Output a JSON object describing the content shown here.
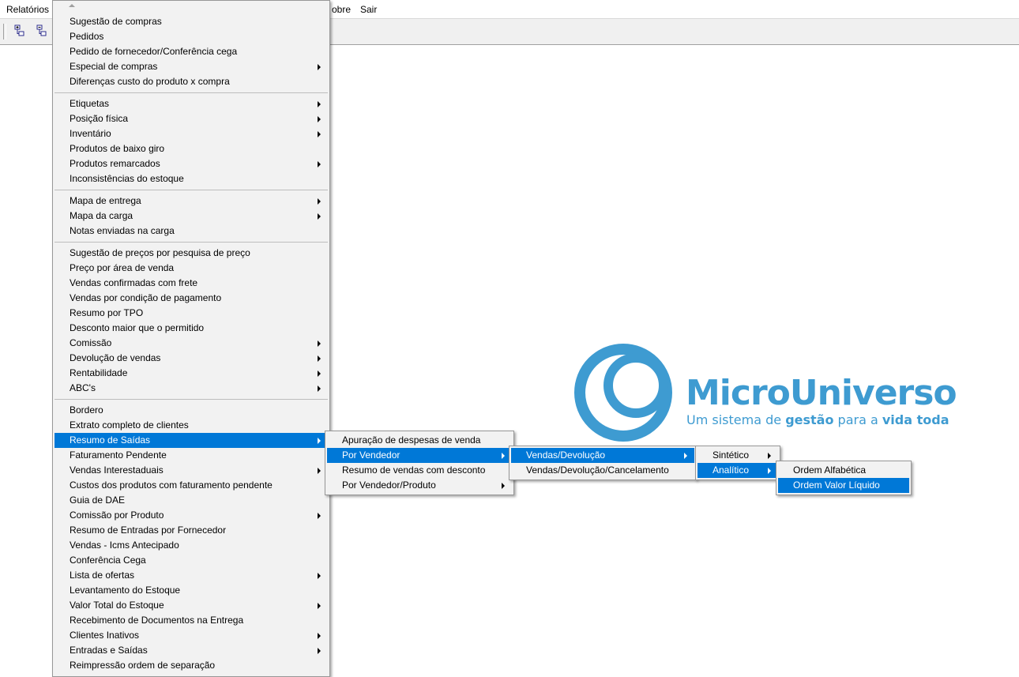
{
  "menubar": {
    "items": [
      {
        "label": "Relatórios"
      },
      {
        "label": "obre"
      },
      {
        "label": "Sair"
      }
    ]
  },
  "toolbar": {
    "buttons": [
      {
        "icon": "tree-expand-icon"
      },
      {
        "icon": "tree-collapse-icon"
      }
    ]
  },
  "main_menu": {
    "items": [
      {
        "label": "Sugestão de compras"
      },
      {
        "label": "Pedidos"
      },
      {
        "label": "Pedido de fornecedor/Conferência cega"
      },
      {
        "label": "Especial de compras",
        "submenu": true
      },
      {
        "label": "Diferenças custo do produto x compra"
      },
      {
        "label": "Etiquetas",
        "submenu": true
      },
      {
        "label": "Posição física",
        "submenu": true
      },
      {
        "label": "Inventário",
        "submenu": true
      },
      {
        "label": "Produtos de baixo giro"
      },
      {
        "label": "Produtos remarcados",
        "submenu": true
      },
      {
        "label": "Inconsistências do estoque"
      },
      {
        "label": "Mapa de entrega",
        "submenu": true
      },
      {
        "label": "Mapa da carga",
        "submenu": true
      },
      {
        "label": "Notas enviadas na carga"
      },
      {
        "label": "Sugestão de preços por pesquisa de preço"
      },
      {
        "label": "Preço por área de venda"
      },
      {
        "label": "Vendas confirmadas com frete"
      },
      {
        "label": "Vendas por condição de pagamento"
      },
      {
        "label": "Resumo por TPO"
      },
      {
        "label": "Desconto maior que o permitido"
      },
      {
        "label": "Comissão",
        "submenu": true
      },
      {
        "label": "Devolução de vendas",
        "submenu": true
      },
      {
        "label": "Rentabilidade",
        "submenu": true
      },
      {
        "label": "ABC's",
        "submenu": true
      },
      {
        "label": "Bordero"
      },
      {
        "label": "Extrato completo de clientes"
      },
      {
        "label": "Resumo de Saídas",
        "submenu": true,
        "highlighted": true
      },
      {
        "label": "Faturamento Pendente"
      },
      {
        "label": "Vendas Interestaduais",
        "submenu": true
      },
      {
        "label": "Custos dos produtos com faturamento pendente"
      },
      {
        "label": "Guia de DAE"
      },
      {
        "label": "Comissão por Produto",
        "submenu": true
      },
      {
        "label": "Resumo de Entradas por Fornecedor"
      },
      {
        "label": "Vendas - Icms Antecipado"
      },
      {
        "label": "Conferência Cega"
      },
      {
        "label": "Lista de ofertas",
        "submenu": true
      },
      {
        "label": "Levantamento do Estoque"
      },
      {
        "label": "Valor Total do Estoque",
        "submenu": true
      },
      {
        "label": "Recebimento de Documentos na Entrega"
      },
      {
        "label": "Clientes Inativos",
        "submenu": true
      },
      {
        "label": "Entradas e Saídas",
        "submenu": true
      },
      {
        "label": "Reimpressão ordem de separação"
      }
    ]
  },
  "submenu_resumo_saidas": {
    "items": [
      {
        "label": "Apuração de despesas de venda"
      },
      {
        "label": "Por Vendedor",
        "submenu": true,
        "highlighted": true
      },
      {
        "label": "Resumo de vendas com desconto"
      },
      {
        "label": "Por Vendedor/Produto",
        "submenu": true
      }
    ]
  },
  "submenu_por_vendedor": {
    "items": [
      {
        "label": "Vendas/Devolução",
        "submenu": true,
        "highlighted": true
      },
      {
        "label": "Vendas/Devolução/Cancelamento"
      }
    ]
  },
  "submenu_vendas_devolucao": {
    "items": [
      {
        "label": "Sintético",
        "submenu": true
      },
      {
        "label": "Analítico",
        "submenu": true,
        "highlighted": true
      }
    ]
  },
  "submenu_analitico": {
    "items": [
      {
        "label": "Ordem Alfabética"
      },
      {
        "label": "Ordem Valor Líquido",
        "highlighted": true
      }
    ]
  },
  "logo": {
    "title": "MicroUniverso",
    "tagline_start": "Um sistema de ",
    "tagline_bold1": "gestão",
    "tagline_mid": " para a ",
    "tagline_bold2": "vida toda",
    "color": "#3e9bd1"
  },
  "colors": {
    "highlight": "#0078d7",
    "menu_bg": "#f2f2f2",
    "toolbar_bg": "#f0f0f0"
  }
}
